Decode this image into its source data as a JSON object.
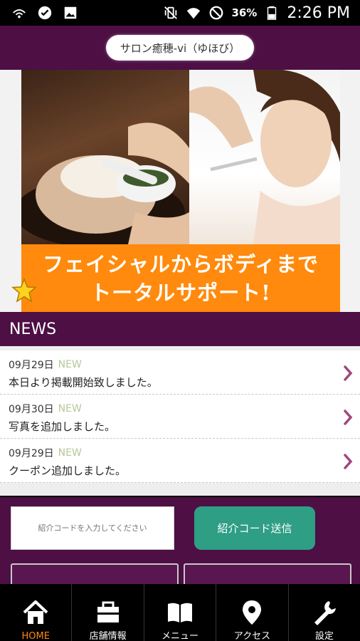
{
  "status_bar": {
    "battery": "36%",
    "time": "2:26 PM",
    "icons_left": [
      "wifi-calling-icon",
      "check-circle-icon",
      "image-icon"
    ],
    "icons_right": [
      "vibrate-icon",
      "wifi-icon",
      "block-icon",
      "battery-icon"
    ]
  },
  "header": {
    "title": "サロン癒穂-vi（ゆほび）"
  },
  "banner": {
    "caption_line1": "フェイシャルからボディまで",
    "caption_line2": "トータルサポート!"
  },
  "news": {
    "title": "NEWS",
    "new_label": "NEW",
    "items": [
      {
        "date": "09月29日",
        "text": "本日より掲載開始致しました。"
      },
      {
        "date": "09月30日",
        "text": "写真を追加しました。"
      },
      {
        "date": "09月29日",
        "text": "クーポン追加しました。"
      }
    ]
  },
  "referral": {
    "placeholder": "紹介コードを入力してください",
    "button_label": "紹介コード送信"
  },
  "nav": {
    "items": [
      {
        "label": "HOME",
        "icon": "home-icon"
      },
      {
        "label": "店舗情報",
        "icon": "store-icon"
      },
      {
        "label": "メニュー",
        "icon": "book-icon"
      },
      {
        "label": "アクセス",
        "icon": "map-pin-icon"
      },
      {
        "label": "設定",
        "icon": "wrench-icon"
      }
    ]
  },
  "colors": {
    "brand": "#4d0f44",
    "accent": "#ff8a0d",
    "button": "#2e9e84",
    "new_badge": "#b5c99a",
    "chevron": "#a0467f"
  }
}
